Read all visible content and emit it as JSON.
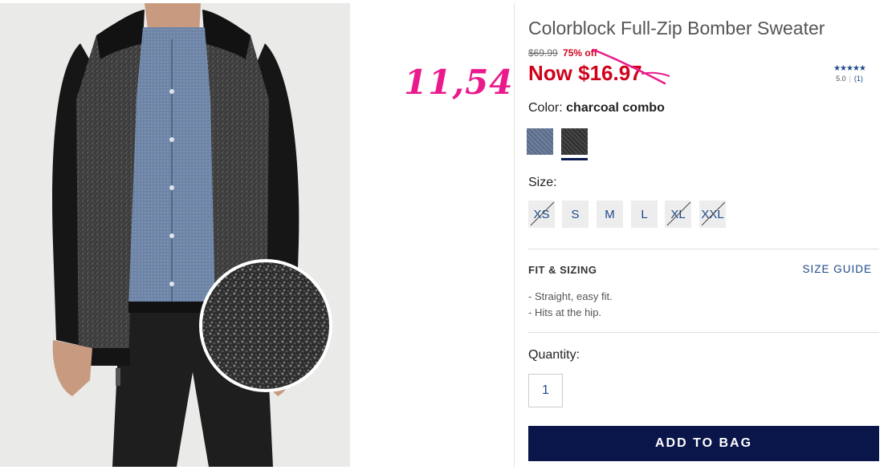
{
  "product": {
    "title": "Colorblock Full-Zip Bomber Sweater",
    "original_price": "$69.99",
    "discount": "75% off",
    "now_price": "Now $16.97",
    "rating": {
      "stars": "★★★★★",
      "score": "5.0",
      "count": "(1)"
    }
  },
  "annotation": {
    "text": "11,54",
    "color": "#ea1a8c"
  },
  "color": {
    "label": "Color:",
    "selected": "charcoal combo",
    "swatches": [
      "blue",
      "charcoal combo"
    ]
  },
  "size": {
    "label": "Size:",
    "options": [
      {
        "label": "XS",
        "available": false
      },
      {
        "label": "S",
        "available": true
      },
      {
        "label": "M",
        "available": true
      },
      {
        "label": "L",
        "available": true
      },
      {
        "label": "XL",
        "available": false
      },
      {
        "label": "XXL",
        "available": false
      }
    ]
  },
  "fit": {
    "title": "FIT & SIZING",
    "guide_link": "SIZE GUIDE",
    "items": [
      "- Straight, easy fit.",
      "- Hits at the hip."
    ]
  },
  "quantity": {
    "label": "Quantity:",
    "value": "1"
  },
  "cta": {
    "add_to_bag": "ADD TO BAG"
  },
  "colors": {
    "sale_red": "#d0021b",
    "link_blue": "#1c4a8a",
    "button_navy": "#0a154a"
  }
}
